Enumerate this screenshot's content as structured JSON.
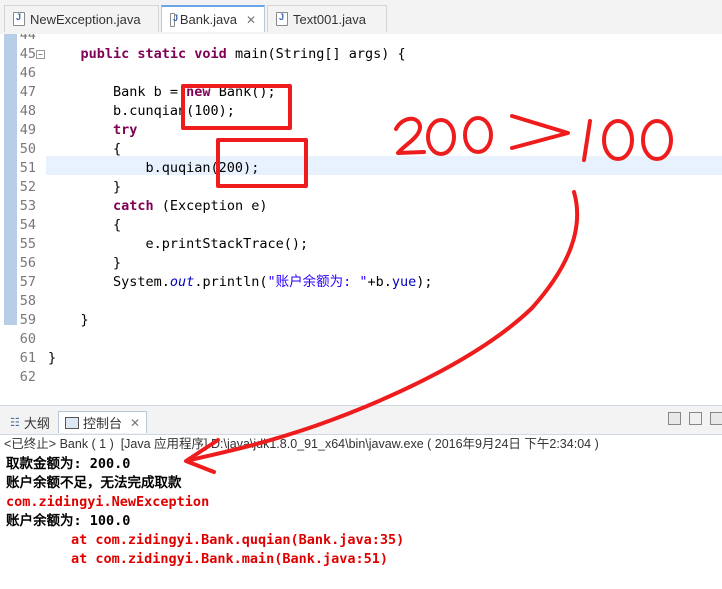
{
  "tabs": [
    {
      "label": "NewException.java",
      "active": false,
      "closable": false
    },
    {
      "label": "Bank.java",
      "active": true,
      "closable": true
    },
    {
      "label": "Text001.java",
      "active": false,
      "closable": false
    }
  ],
  "editor": {
    "lines": [
      {
        "n": "44",
        "html": ""
      },
      {
        "n": "45",
        "html": "    <span class='kw'>public static void</span> main(String[] args) {"
      },
      {
        "n": "46",
        "html": ""
      },
      {
        "n": "47",
        "html": "        Bank b = <span class='kw'>new</span> Bank();"
      },
      {
        "n": "48",
        "html": "        b.cunqian(100);"
      },
      {
        "n": "49",
        "html": "        <span class='kw'>try</span>"
      },
      {
        "n": "50",
        "html": "        {"
      },
      {
        "n": "51",
        "html": "            b.quqian(200);"
      },
      {
        "n": "52",
        "html": "        }"
      },
      {
        "n": "53",
        "html": "        <span class='kw'>catch</span> (Exception e)"
      },
      {
        "n": "54",
        "html": "        {"
      },
      {
        "n": "55",
        "html": "            e.printStackTrace();"
      },
      {
        "n": "56",
        "html": "        }"
      },
      {
        "n": "57",
        "html": "        System.<span class='it'>out</span>.println(<span class='str'>\"账户余额为: \"</span>+b.<span class='fld'>yue</span>);"
      },
      {
        "n": "58",
        "html": ""
      },
      {
        "n": "59",
        "html": "    }"
      },
      {
        "n": "60",
        "html": ""
      },
      {
        "n": "61",
        "html": "}"
      },
      {
        "n": "62",
        "html": ""
      }
    ]
  },
  "panel": {
    "tab_outline": "大纲",
    "tab_console": "控制台",
    "header": "<已终止> Bank ( 1 )  [Java 应用程序] D:\\java\\jdk1.8.0_91_x64\\bin\\javaw.exe ( 2016年9月24日 下午2:34:04 )"
  },
  "console": [
    {
      "text": "取款金额为: 200.0",
      "color": "black"
    },
    {
      "text": "账户余额不足，无法完成取款",
      "color": "black"
    },
    {
      "text": "com.zidingyi.NewException",
      "color": "red"
    },
    {
      "text": "账户余额为: 100.0",
      "color": "black"
    },
    {
      "text": "        at com.zidingyi.Bank.quqian(Bank.java:35)",
      "color": "red"
    },
    {
      "text": "        at com.zidingyi.Bank.main(Bank.java:51)",
      "color": "red"
    }
  ],
  "annotation": {
    "handwriting": "200 >100",
    "color": "#ee1c1c"
  }
}
